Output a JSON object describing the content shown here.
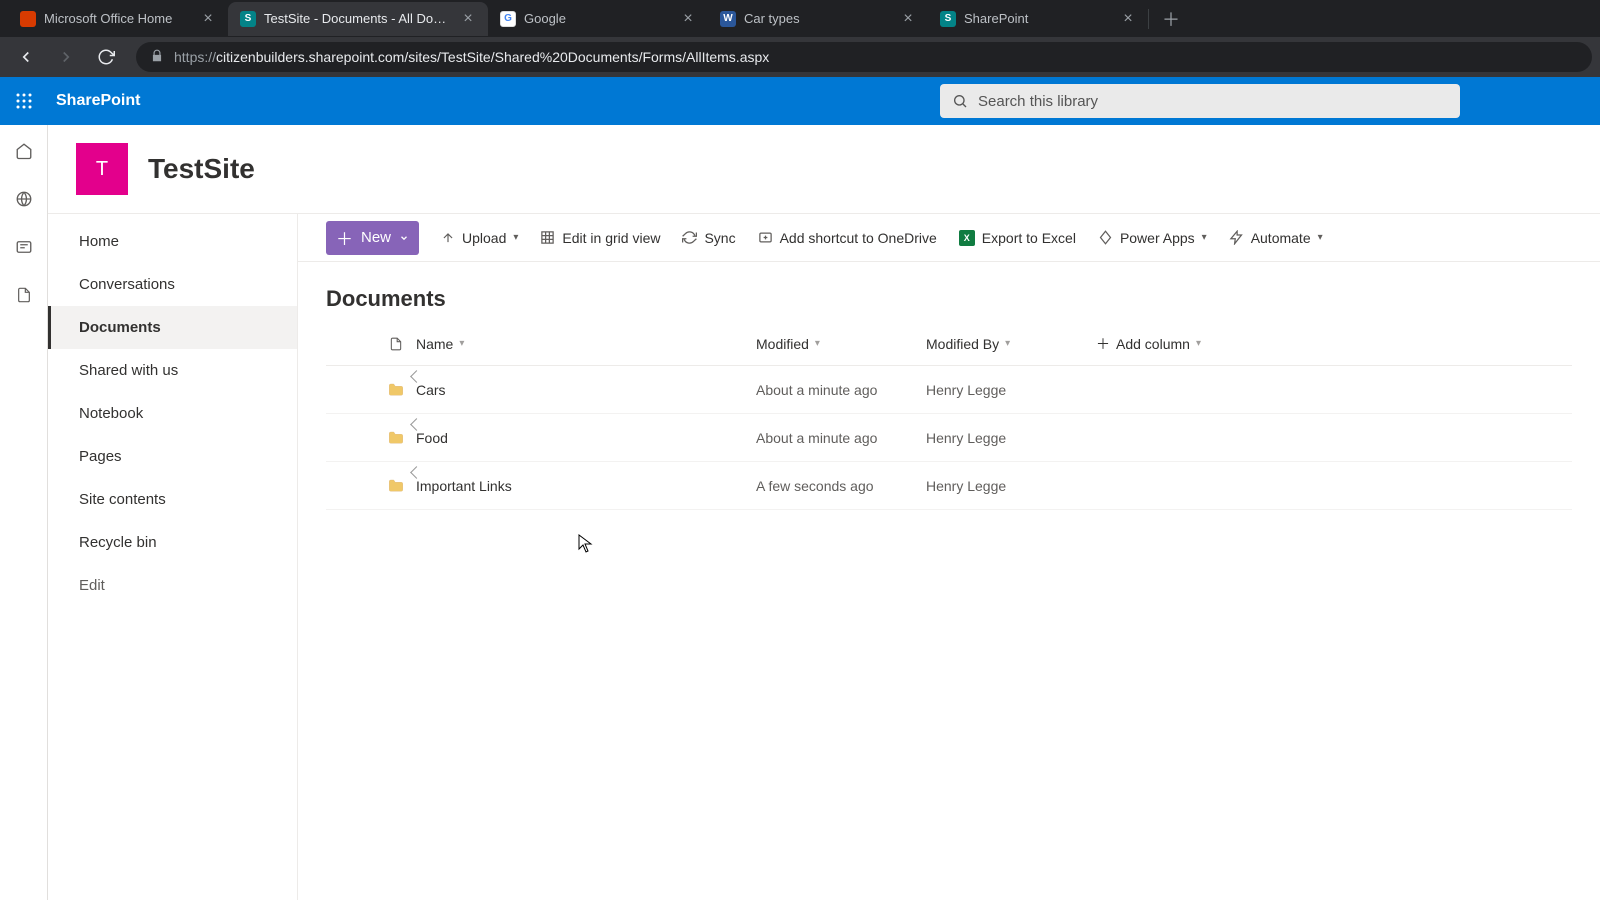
{
  "browser": {
    "tabs": [
      {
        "title": "Microsoft Office Home",
        "favicon_bg": "#d83b01",
        "favicon_text": "",
        "active": false
      },
      {
        "title": "TestSite - Documents - All Docum",
        "favicon_bg": "#038387",
        "favicon_text": "S",
        "active": true
      },
      {
        "title": "Google",
        "favicon_bg": "#ffffff",
        "favicon_text": "G",
        "active": false
      },
      {
        "title": "Car types",
        "favicon_bg": "#2b579a",
        "favicon_text": "W",
        "active": false
      },
      {
        "title": "SharePoint",
        "favicon_bg": "#038387",
        "favicon_text": "S",
        "active": false
      }
    ],
    "url": "citizenbuilders.sharepoint.com/sites/TestSite/Shared%20Documents/Forms/AllItems.aspx",
    "url_prefix": "https://"
  },
  "suite": {
    "brand": "SharePoint",
    "search_placeholder": "Search this library"
  },
  "site": {
    "logo_letter": "T",
    "title": "TestSite"
  },
  "leftnav": {
    "items": [
      {
        "label": "Home"
      },
      {
        "label": "Conversations"
      },
      {
        "label": "Documents",
        "selected": true
      },
      {
        "label": "Shared with us"
      },
      {
        "label": "Notebook"
      },
      {
        "label": "Pages"
      },
      {
        "label": "Site contents"
      },
      {
        "label": "Recycle bin"
      }
    ],
    "edit_label": "Edit"
  },
  "cmdbar": {
    "new": "New",
    "upload": "Upload",
    "edit_grid": "Edit in grid view",
    "sync": "Sync",
    "shortcut": "Add shortcut to OneDrive",
    "export": "Export to Excel",
    "power_apps": "Power Apps",
    "automate": "Automate"
  },
  "library": {
    "title": "Documents",
    "columns": {
      "name": "Name",
      "modified": "Modified",
      "modified_by": "Modified By",
      "add": "Add column"
    },
    "rows": [
      {
        "name": "Cars",
        "modified": "About a minute ago",
        "by": "Henry Legge"
      },
      {
        "name": "Food",
        "modified": "About a minute ago",
        "by": "Henry Legge"
      },
      {
        "name": "Important Links",
        "modified": "A few seconds ago",
        "by": "Henry Legge"
      }
    ]
  }
}
